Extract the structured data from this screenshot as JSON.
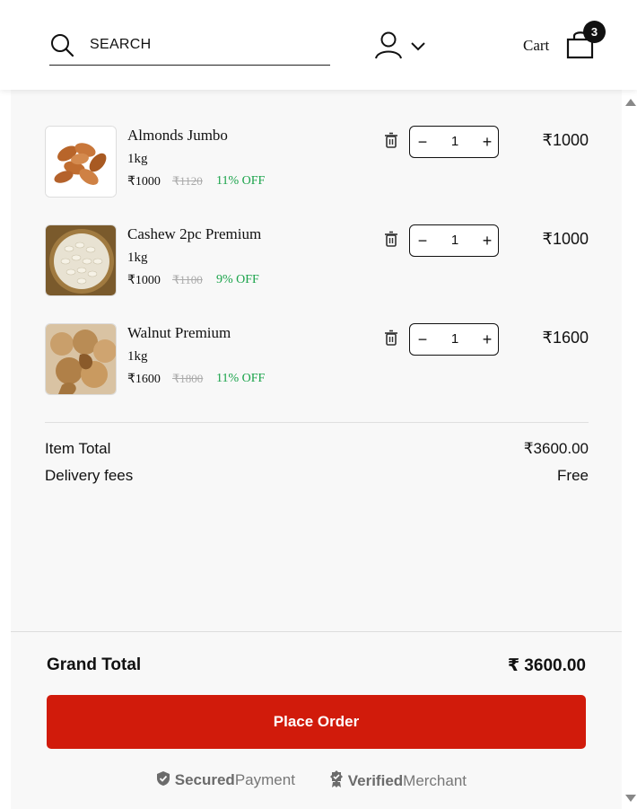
{
  "search": {
    "placeholder": "SEARCH"
  },
  "cart": {
    "label": "Cart",
    "count": "3"
  },
  "items": [
    {
      "name": "Almonds Jumbo",
      "weight": "1kg",
      "price": "₹1000",
      "original_price": "₹1120",
      "discount": "11% OFF",
      "quantity": "1",
      "minus": "−",
      "plus": "+",
      "total": "₹1000",
      "image": "almonds-image"
    },
    {
      "name": "Cashew 2pc Premium",
      "weight": "1kg",
      "price": "₹1000",
      "original_price": "₹1100",
      "discount": "9% OFF",
      "quantity": "1",
      "minus": "−",
      "plus": "+",
      "total": "₹1000",
      "image": "cashew-image"
    },
    {
      "name": "Walnut Premium",
      "weight": "1kg",
      "price": "₹1600",
      "original_price": "₹1800",
      "discount": "11% OFF",
      "quantity": "1",
      "minus": "−",
      "plus": "+",
      "total": "₹1600",
      "image": "walnut-image"
    }
  ],
  "summary": {
    "item_total_label": "Item Total",
    "item_total_value": "₹3600.00",
    "delivery_label": "Delivery fees",
    "delivery_value": "Free"
  },
  "grand_total": {
    "label": "Grand Total",
    "value": "₹ 3600.00"
  },
  "place_order_label": "Place Order",
  "trust": {
    "secured_bold": "Secured",
    "secured_rest": "Payment",
    "verified_bold": "Verified",
    "verified_rest": "Merchant"
  },
  "colors": {
    "accent": "#d11b0b",
    "discount": "#1aa34a",
    "background": "#f8f8f8"
  },
  "icons": [
    "search-icon",
    "user-icon",
    "chevron-down-icon",
    "shopping-bag-icon",
    "trash-icon",
    "shield-check-icon",
    "verified-badge-icon"
  ]
}
